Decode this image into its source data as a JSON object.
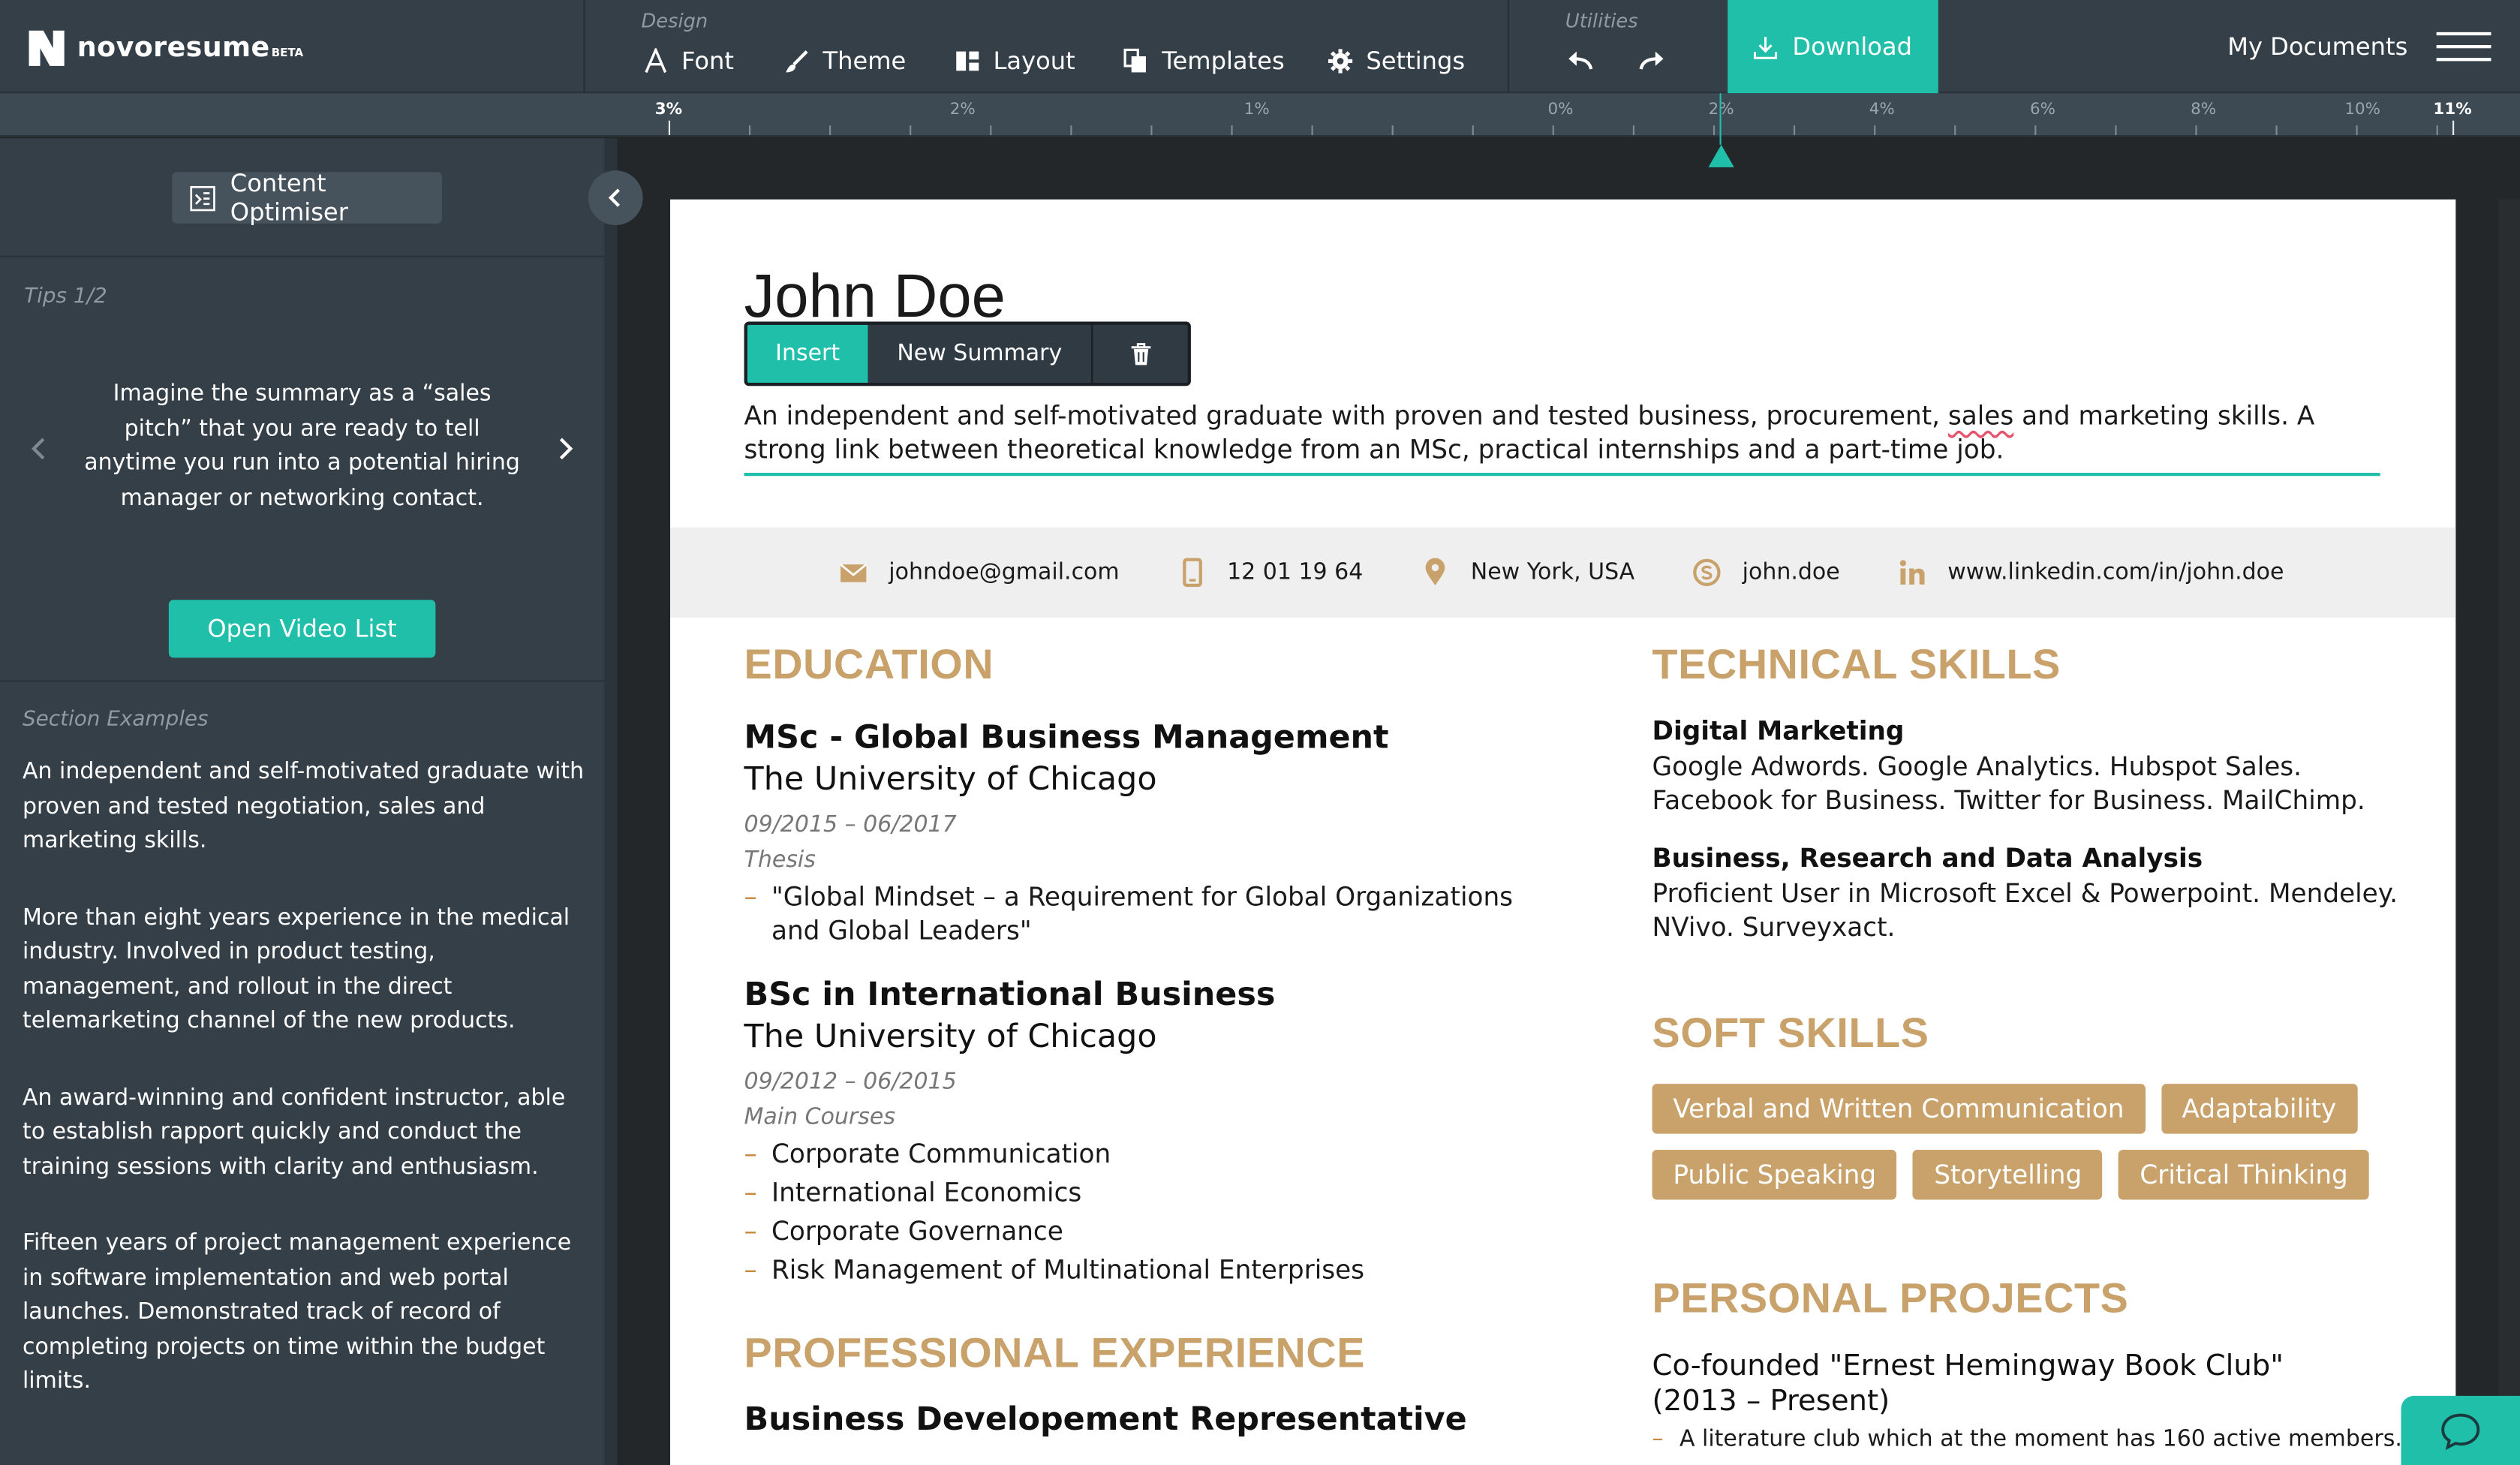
{
  "app": {
    "logo_text": "novoresume",
    "logo_badge": "BETA"
  },
  "toolbar": {
    "design_label": "Design",
    "utilities_label": "Utilities",
    "font": "Font",
    "theme": "Theme",
    "layout": "Layout",
    "templates": "Templates",
    "settings": "Settings",
    "download": "Download",
    "my_documents": "My Documents"
  },
  "ruler": {
    "labels": [
      "3%",
      "2%",
      "1%",
      "0%",
      "2%",
      "4%",
      "6%",
      "8%",
      "10%",
      "11%"
    ],
    "marker_value": "2%"
  },
  "left_panel": {
    "content_optimiser": "Content Optimiser",
    "tips_label": "Tips 1/2",
    "tip_text": "Imagine the summary as a “sales pitch” that you are ready to tell anytime you run into a potential hiring manager or networking contact.",
    "video_button": "Open Video List",
    "examples_label": "Section Examples",
    "examples": [
      "An independent and self-motivated graduate with proven and tested negotiation, sales and marketing skills.",
      "More than eight years experience in the medical industry. Involved in product testing, management, and rollout in the direct telemarketing channel of the new products.",
      "An award-winning and confident instructor, able to establish rapport quickly and conduct the training sessions with clarity and enthusiasm.",
      "Fifteen years of project management experience in software implementation and web portal launches. Demonstrated track of record of completing projects on time within the budget limits."
    ]
  },
  "resume": {
    "name": "John Doe",
    "edit_toolbar": {
      "insert": "Insert",
      "new_summary": "New Summary"
    },
    "summary_before": "An independent and self-motivated graduate with proven and tested business, procurement, ",
    "summary_flagged": "sales",
    "summary_after": " and marketing skills. A strong link between theoretical knowledge from an MSc, practical internships and a part-time job.",
    "contacts": {
      "email": "johndoe@gmail.com",
      "phone": "12 01 19 64",
      "location": "New York, USA",
      "skype": "john.doe",
      "linkedin": "www.linkedin.com/in/john.doe"
    },
    "education": {
      "title": "EDUCATION",
      "items": [
        {
          "degree": "MSc - Global Business Management",
          "school": "The University of Chicago",
          "dates": "09/2015 – 06/2017",
          "subhead": "Thesis",
          "bullets": [
            "\"Global Mindset – a Requirement for Global Organizations and Global Leaders\""
          ]
        },
        {
          "degree": "BSc in International Business",
          "school": "The University of Chicago",
          "dates": "09/2012 – 06/2015",
          "subhead": "Main Courses",
          "bullets": [
            "Corporate Communication",
            "International Economics",
            "Corporate Governance",
            "Risk Management of Multinational Enterprises"
          ]
        }
      ]
    },
    "experience": {
      "title": "PROFESSIONAL EXPERIENCE",
      "first_role": "Business Developement Representative"
    },
    "technical_skills": {
      "title": "TECHNICAL SKILLS",
      "groups": [
        {
          "name": "Digital Marketing",
          "text": "Google Adwords. Google Analytics. Hubspot Sales. Facebook for Business. Twitter for Business. MailChimp."
        },
        {
          "name": "Business, Research and Data Analysis",
          "text": "Proficient User in Microsoft Excel & Powerpoint. Mendeley. NVivo. Surveyxact."
        }
      ]
    },
    "soft_skills": {
      "title": "SOFT SKILLS",
      "tags": [
        "Verbal and Written Communication",
        "Adaptability",
        "Public Speaking",
        "Storytelling",
        "Critical Thinking"
      ]
    },
    "personal_projects": {
      "title": "PERSONAL PROJECTS",
      "project_title": "Co-founded \"Ernest Hemingway Book Club\" (2013 – Present)",
      "project_bullet": "A literature club which at the moment has 160 active members."
    }
  },
  "colors": {
    "accent": "#1fbfa9",
    "section_gold": "#c9a26b",
    "panel": "#343f48"
  }
}
